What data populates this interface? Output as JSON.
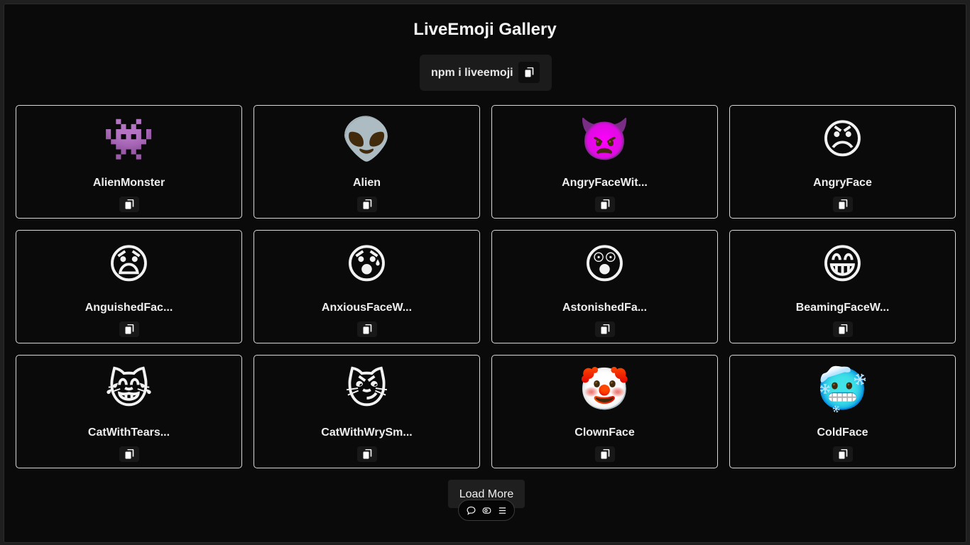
{
  "page": {
    "title": "LiveEmoji Gallery"
  },
  "install": {
    "command": "npm i liveemoji",
    "copy_icon": "copy-icon"
  },
  "emojis": [
    {
      "glyph": "👾",
      "name": "AlienMonster"
    },
    {
      "glyph": "👽",
      "name": "Alien"
    },
    {
      "glyph": "👿",
      "name": "AngryFaceWit..."
    },
    {
      "glyph": "😠",
      "name": "AngryFace"
    },
    {
      "glyph": "😧",
      "name": "AnguishedFac..."
    },
    {
      "glyph": "😰",
      "name": "AnxiousFaceW..."
    },
    {
      "glyph": "😲",
      "name": "AstonishedFa..."
    },
    {
      "glyph": "😁",
      "name": "BeamingFaceW..."
    },
    {
      "glyph": "😹",
      "name": "CatWithTears..."
    },
    {
      "glyph": "😼",
      "name": "CatWithWrySm..."
    },
    {
      "glyph": "🤡",
      "name": "ClownFace"
    },
    {
      "glyph": "🥶",
      "name": "ColdFace"
    }
  ],
  "load_more": {
    "label": "Load More"
  },
  "toolbar": {
    "icons": [
      "comment-icon",
      "eye-icon",
      "menu-icon"
    ]
  },
  "colors": {
    "background": "#0a0a0a",
    "card_border": "#d8d8d8",
    "text": "#f2f2f2"
  }
}
